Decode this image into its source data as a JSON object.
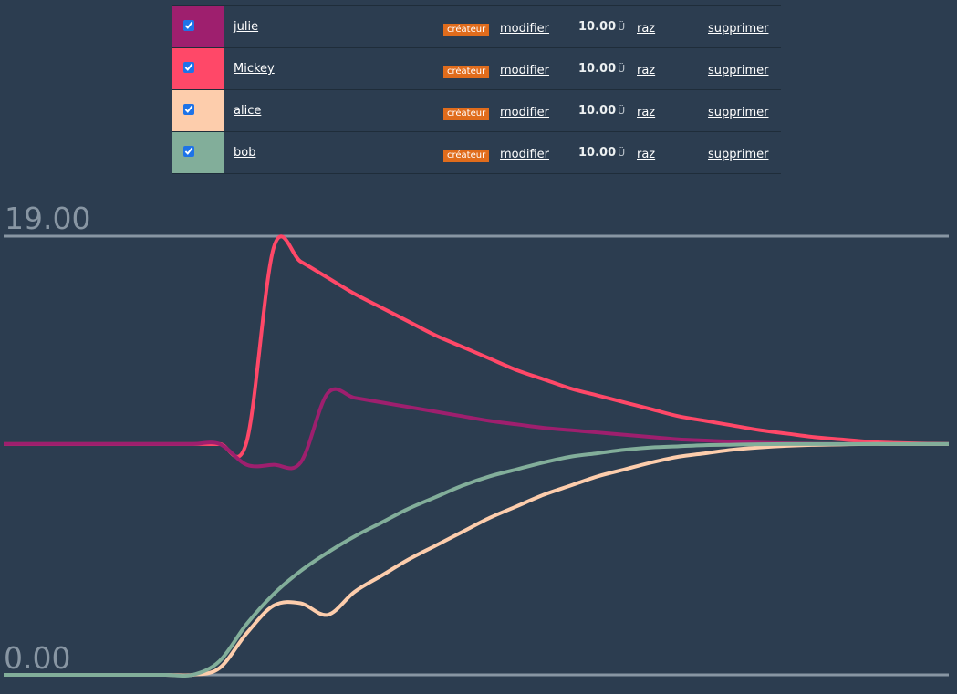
{
  "users": [
    {
      "name": "julie",
      "color": "#9e1f6e",
      "checked": true,
      "badge": "créateur",
      "modify": "modifier",
      "amount": "10.00",
      "unit": "Ü",
      "reset": "raz",
      "delete": "supprimer"
    },
    {
      "name": "Mickey",
      "color": "#ff4868",
      "checked": true,
      "badge": "créateur",
      "modify": "modifier",
      "amount": "10.00",
      "unit": "Ü",
      "reset": "raz",
      "delete": "supprimer"
    },
    {
      "name": "alice",
      "color": "#fdcdac",
      "checked": true,
      "badge": "créateur",
      "modify": "modifier",
      "amount": "10.00",
      "unit": "Ü",
      "reset": "raz",
      "delete": "supprimer"
    },
    {
      "name": "bob",
      "color": "#82ae9a",
      "checked": true,
      "badge": "créateur",
      "modify": "modifier",
      "amount": "10.00",
      "unit": "Ü",
      "reset": "raz",
      "delete": "supprimer"
    }
  ],
  "chart_data": {
    "type": "line",
    "ylim": [
      0,
      19
    ],
    "y_labels": [
      "19.00",
      "0.00"
    ],
    "x": [
      0,
      2,
      4,
      6,
      8,
      10,
      12,
      14,
      16,
      18,
      20,
      22,
      24,
      26,
      28,
      30,
      32,
      34,
      36,
      38,
      40,
      42,
      44,
      46,
      48,
      50,
      52,
      54,
      56,
      58,
      60,
      62,
      64,
      66,
      68,
      70
    ],
    "series": [
      {
        "color": "#ff4868",
        "values": [
          10,
          10,
          10,
          10,
          10,
          10,
          10,
          10,
          10,
          10.1,
          18.5,
          17.9,
          17.2,
          16.5,
          15.9,
          15.3,
          14.7,
          14.2,
          13.7,
          13.2,
          12.8,
          12.4,
          12.1,
          11.8,
          11.5,
          11.2,
          11.0,
          10.8,
          10.6,
          10.45,
          10.3,
          10.2,
          10.1,
          10.05,
          10.02,
          10
        ]
      },
      {
        "color": "#9e1f6e",
        "values": [
          10,
          10,
          10,
          10,
          10,
          10,
          10,
          10,
          10,
          9.1,
          9.1,
          9.2,
          12.2,
          12.0,
          11.8,
          11.6,
          11.4,
          11.2,
          11.0,
          10.85,
          10.7,
          10.6,
          10.5,
          10.4,
          10.3,
          10.2,
          10.15,
          10.1,
          10.06,
          10.03,
          10.01,
          10,
          10,
          10,
          10,
          10
        ]
      },
      {
        "color": "#fdcdac",
        "values": [
          0,
          0,
          0,
          0,
          0,
          0,
          0,
          0,
          0.3,
          1.8,
          3.0,
          3.1,
          2.6,
          3.6,
          4.3,
          5.0,
          5.6,
          6.2,
          6.8,
          7.3,
          7.8,
          8.2,
          8.6,
          8.9,
          9.2,
          9.45,
          9.6,
          9.75,
          9.85,
          9.92,
          9.96,
          9.98,
          10,
          10,
          10,
          10
        ]
      },
      {
        "color": "#82ae9a",
        "values": [
          0,
          0,
          0,
          0,
          0,
          0,
          0,
          0,
          0.6,
          2.2,
          3.5,
          4.5,
          5.3,
          6.0,
          6.6,
          7.2,
          7.7,
          8.2,
          8.6,
          8.9,
          9.2,
          9.45,
          9.6,
          9.75,
          9.85,
          9.9,
          9.95,
          9.97,
          9.99,
          10,
          10,
          10,
          10,
          10,
          10,
          10
        ]
      }
    ]
  }
}
